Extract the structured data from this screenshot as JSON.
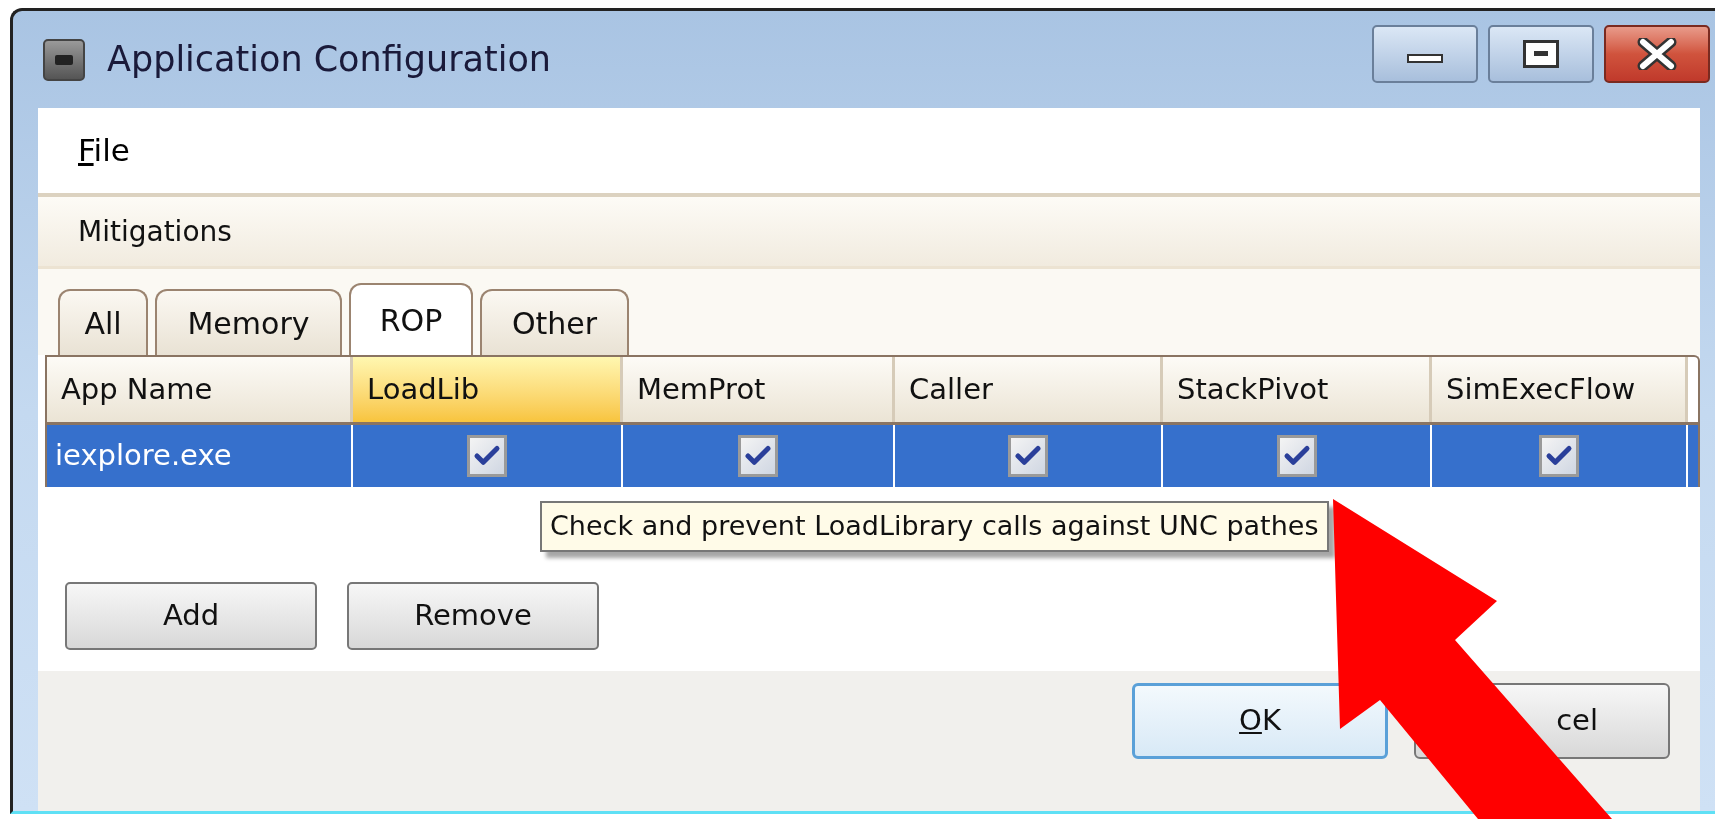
{
  "window": {
    "title": "Application Configuration"
  },
  "menu": [
    {
      "label": "File"
    }
  ],
  "panel": {
    "title": "Mitigations"
  },
  "tabs": [
    {
      "label": "All",
      "selected": false
    },
    {
      "label": "Memory",
      "selected": false
    },
    {
      "label": "ROP",
      "selected": true
    },
    {
      "label": "Other",
      "selected": false
    }
  ],
  "table": {
    "columns": [
      {
        "label": "App Name",
        "highlighted": false
      },
      {
        "label": "LoadLib",
        "highlighted": true
      },
      {
        "label": "MemProt",
        "highlighted": false
      },
      {
        "label": "Caller",
        "highlighted": false
      },
      {
        "label": "StackPivot",
        "highlighted": false
      },
      {
        "label": "SimExecFlow",
        "highlighted": false
      }
    ],
    "rows": [
      {
        "selected": true,
        "app_name": "iexplore.exe",
        "cells": [
          {
            "checked": true
          },
          {
            "checked": true
          },
          {
            "checked": true
          },
          {
            "checked": true
          },
          {
            "checked": true
          }
        ]
      }
    ]
  },
  "tooltip": "Check and prevent LoadLibrary calls against UNC pathes",
  "buttons": [
    "Add",
    "Remove"
  ],
  "dialog_buttons": [
    {
      "label": "OK",
      "default": true
    },
    {
      "label": "cel",
      "default": false
    }
  ]
}
